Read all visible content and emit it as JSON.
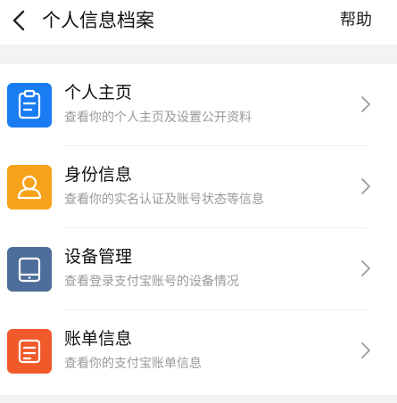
{
  "header": {
    "title": "个人信息档案",
    "help_label": "帮助"
  },
  "colors": {
    "blue": "#1a7cf2",
    "orange": "#f7a21b",
    "slate": "#4d6d9a",
    "red": "#f05a2a"
  },
  "items": [
    {
      "icon": "clipboard-icon",
      "label": "个人主页",
      "desc": "查看你的个人主页及设置公开资料"
    },
    {
      "icon": "user-icon",
      "label": "身份信息",
      "desc": "查看你的实名认证及账号状态等信息"
    },
    {
      "icon": "device-icon",
      "label": "设备管理",
      "desc": "查看登录支付宝账号的设备情况"
    },
    {
      "icon": "bill-icon",
      "label": "账单信息",
      "desc": "查看你的支付宝账单信息"
    }
  ]
}
